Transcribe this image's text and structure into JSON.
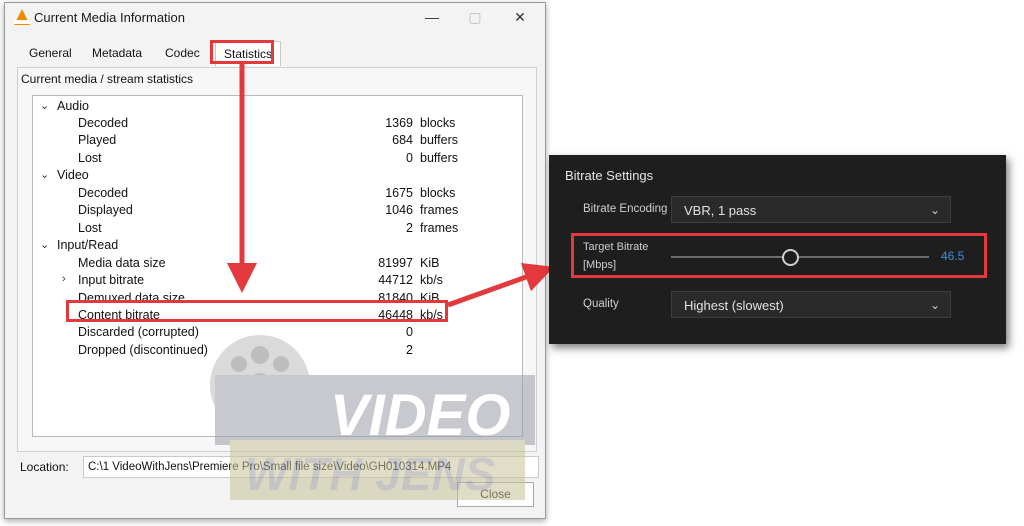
{
  "vlc": {
    "title": "Current Media Information",
    "controls": {
      "minimize": "—",
      "maximize": "▢",
      "close": "✕"
    },
    "tabs": [
      {
        "label": "General"
      },
      {
        "label": "Metadata"
      },
      {
        "label": "Codec"
      },
      {
        "label": "Statistics",
        "active": true
      }
    ],
    "section_title": "Current media / stream statistics",
    "tree": {
      "audio": {
        "label": "Audio",
        "rows": [
          {
            "label": "Decoded",
            "value": "1369",
            "unit": "blocks"
          },
          {
            "label": "Played",
            "value": "684",
            "unit": "buffers"
          },
          {
            "label": "Lost",
            "value": "0",
            "unit": "buffers"
          }
        ]
      },
      "video": {
        "label": "Video",
        "rows": [
          {
            "label": "Decoded",
            "value": "1675",
            "unit": "blocks"
          },
          {
            "label": "Displayed",
            "value": "1046",
            "unit": "frames"
          },
          {
            "label": "Lost",
            "value": "2",
            "unit": "frames"
          }
        ]
      },
      "input": {
        "label": "Input/Read",
        "rows": [
          {
            "label": "Media data size",
            "value": "81997",
            "unit": "KiB"
          },
          {
            "label": "Input bitrate",
            "value": "44712",
            "unit": "kb/s"
          },
          {
            "label": "Demuxed data size",
            "value": "81840",
            "unit": "KiB"
          },
          {
            "label": "Content bitrate",
            "value": "46448",
            "unit": "kb/s"
          },
          {
            "label": "Discarded (corrupted)",
            "value": "0",
            "unit": ""
          },
          {
            "label": "Dropped (discontinued)",
            "value": "2",
            "unit": ""
          }
        ]
      }
    },
    "location_label": "Location:",
    "location_value": "C:\\1 VideoWithJens\\Premiere Pro\\Small file size\\Video\\GH010314.MP4",
    "close_label": "Close"
  },
  "bitrate_settings": {
    "title": "Bitrate Settings",
    "encoding_label": "Bitrate Encoding",
    "encoding_value": "VBR, 1 pass",
    "target_label_line1": "Target Bitrate",
    "target_label_line2": "[Mbps]",
    "target_value": "46.5",
    "target_fraction": 0.46,
    "quality_label": "Quality",
    "quality_value": "Highest (slowest)"
  },
  "watermark": {
    "line1": "VIDEO",
    "line2": "WITH JENS"
  },
  "colors": {
    "highlight": "#e3383c",
    "accent_blue": "#3d8fe8",
    "vlc_orange": "#f08a00",
    "panel_dark": "#1e1e1e"
  },
  "icons": [
    "vlc-cone-icon",
    "chevron-down-icon",
    "chevron-right-icon",
    "film-reel-icon",
    "arrow-icon"
  ]
}
